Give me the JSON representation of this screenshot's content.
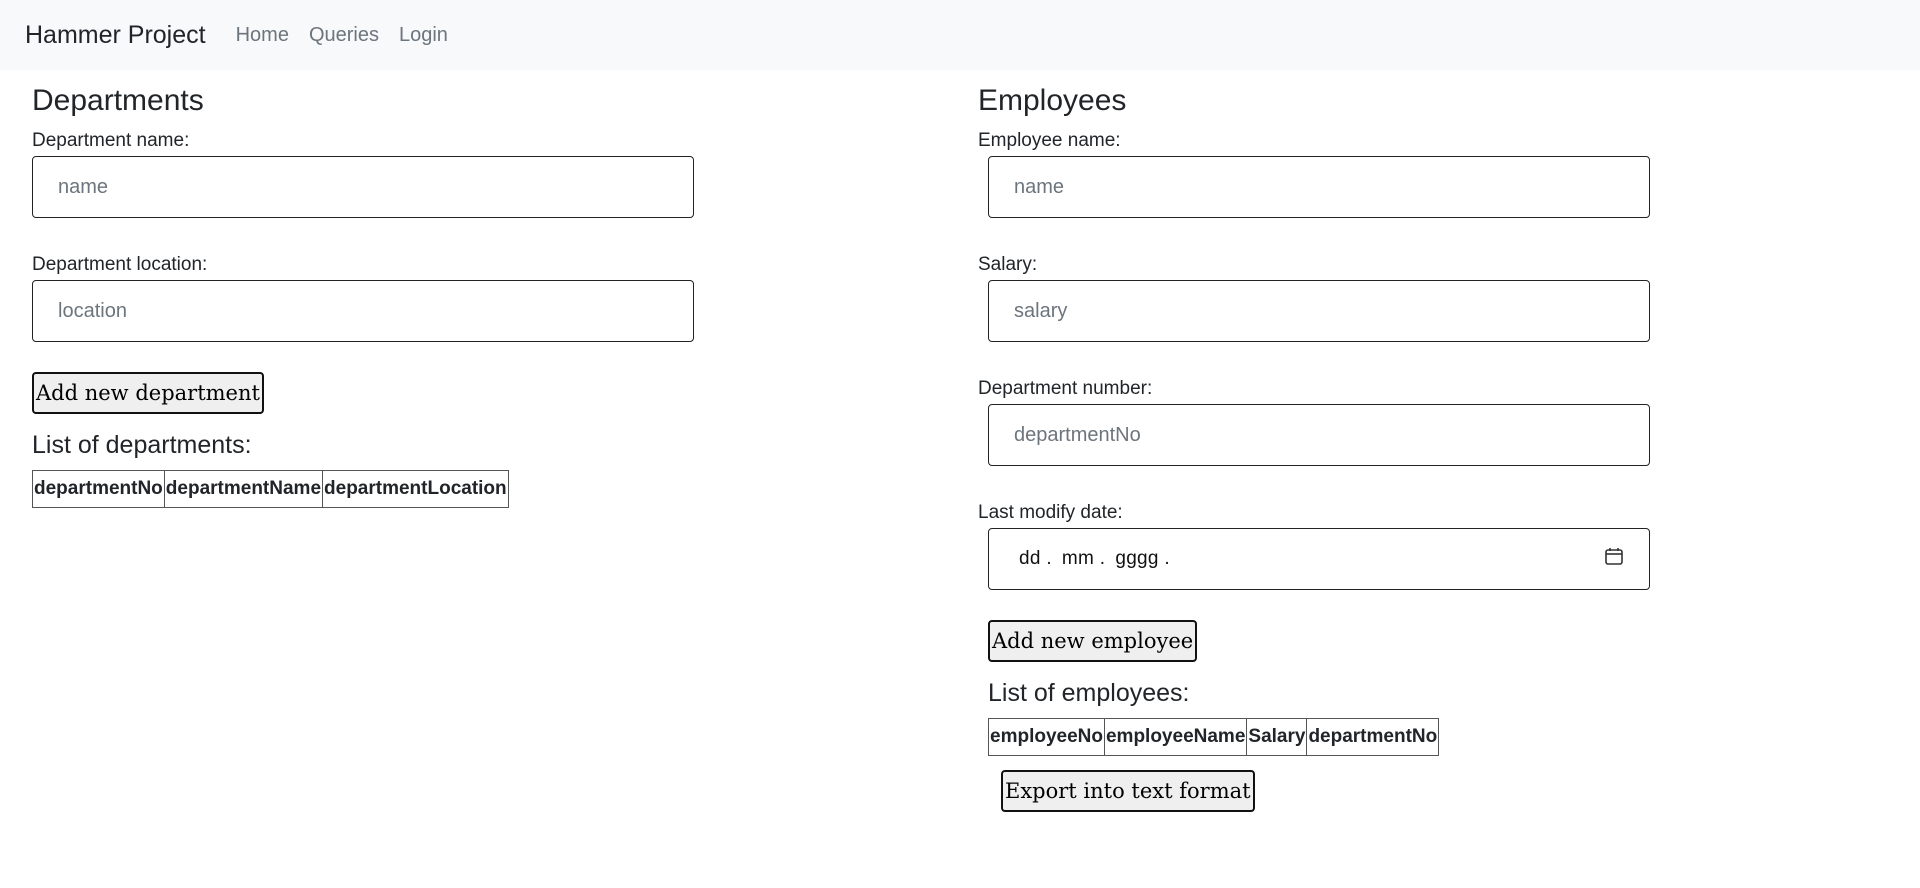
{
  "navbar": {
    "brand": "Hammer Project",
    "links": [
      "Home",
      "Queries",
      "Login"
    ]
  },
  "departments": {
    "title": "Departments",
    "name_label": "Department name:",
    "name_placeholder": "name",
    "location_label": "Department location:",
    "location_placeholder": "location",
    "add_button": "Add new department",
    "list_title": "List of departments:",
    "columns": [
      "departmentNo",
      "departmentName",
      "departmentLocation"
    ]
  },
  "employees": {
    "title": "Employees",
    "name_label": "Employee name:",
    "name_placeholder": "name",
    "salary_label": "Salary:",
    "salary_placeholder": "salary",
    "dept_label": "Department number:",
    "dept_placeholder": "departmentNo",
    "date_label": "Last modify date:",
    "date_placeholder": {
      "day": "dd .",
      "month": "mm .",
      "year": "gggg ."
    },
    "add_button": "Add new employee",
    "list_title": "List of employees:",
    "columns": [
      "employeeNo",
      "employeeName",
      "Salary",
      "departmentNo"
    ],
    "export_button": "Export into text format"
  }
}
